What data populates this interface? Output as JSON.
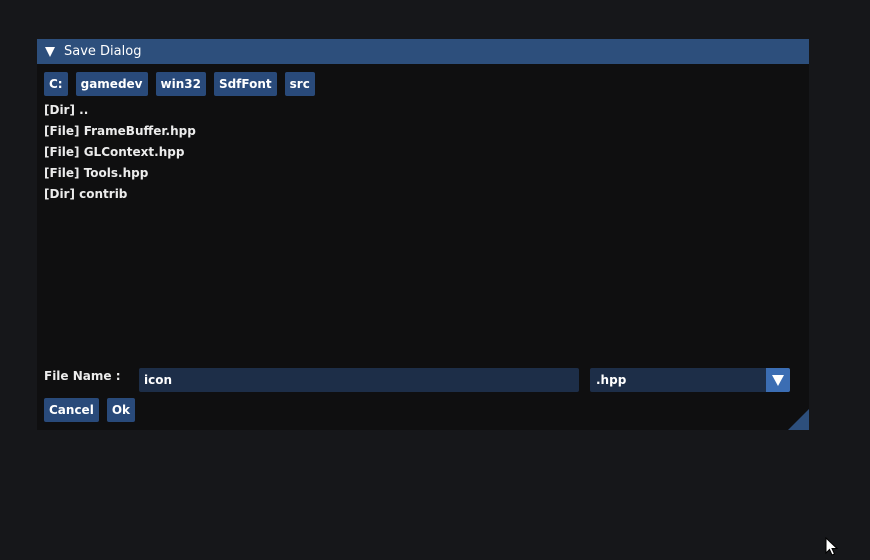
{
  "window": {
    "title": "Save Dialog"
  },
  "breadcrumb": [
    "C:",
    "gamedev",
    "win32",
    "SdfFont",
    "src"
  ],
  "files": [
    "[Dir] ..",
    "[File] FrameBuffer.hpp",
    "[File] GLContext.hpp",
    "[File] Tools.hpp",
    "[Dir] contrib"
  ],
  "filename": {
    "label": "File Name :",
    "value": "icon"
  },
  "filter": {
    "selected": ".hpp"
  },
  "buttons": {
    "cancel": "Cancel",
    "ok": "Ok"
  },
  "colors": {
    "titlebar": "#2d4f7c",
    "button": "#294a7a",
    "input_bg": "#1d2e48",
    "combo_arrow": "#3b6db3",
    "window_bg": "#0f0f10",
    "desktop_bg": "#16171a"
  },
  "icons": {
    "collapse": "triangle-down-icon",
    "combo": "chevron-down-icon",
    "resize": "resize-grip-icon",
    "cursor": "mouse-cursor-icon"
  }
}
